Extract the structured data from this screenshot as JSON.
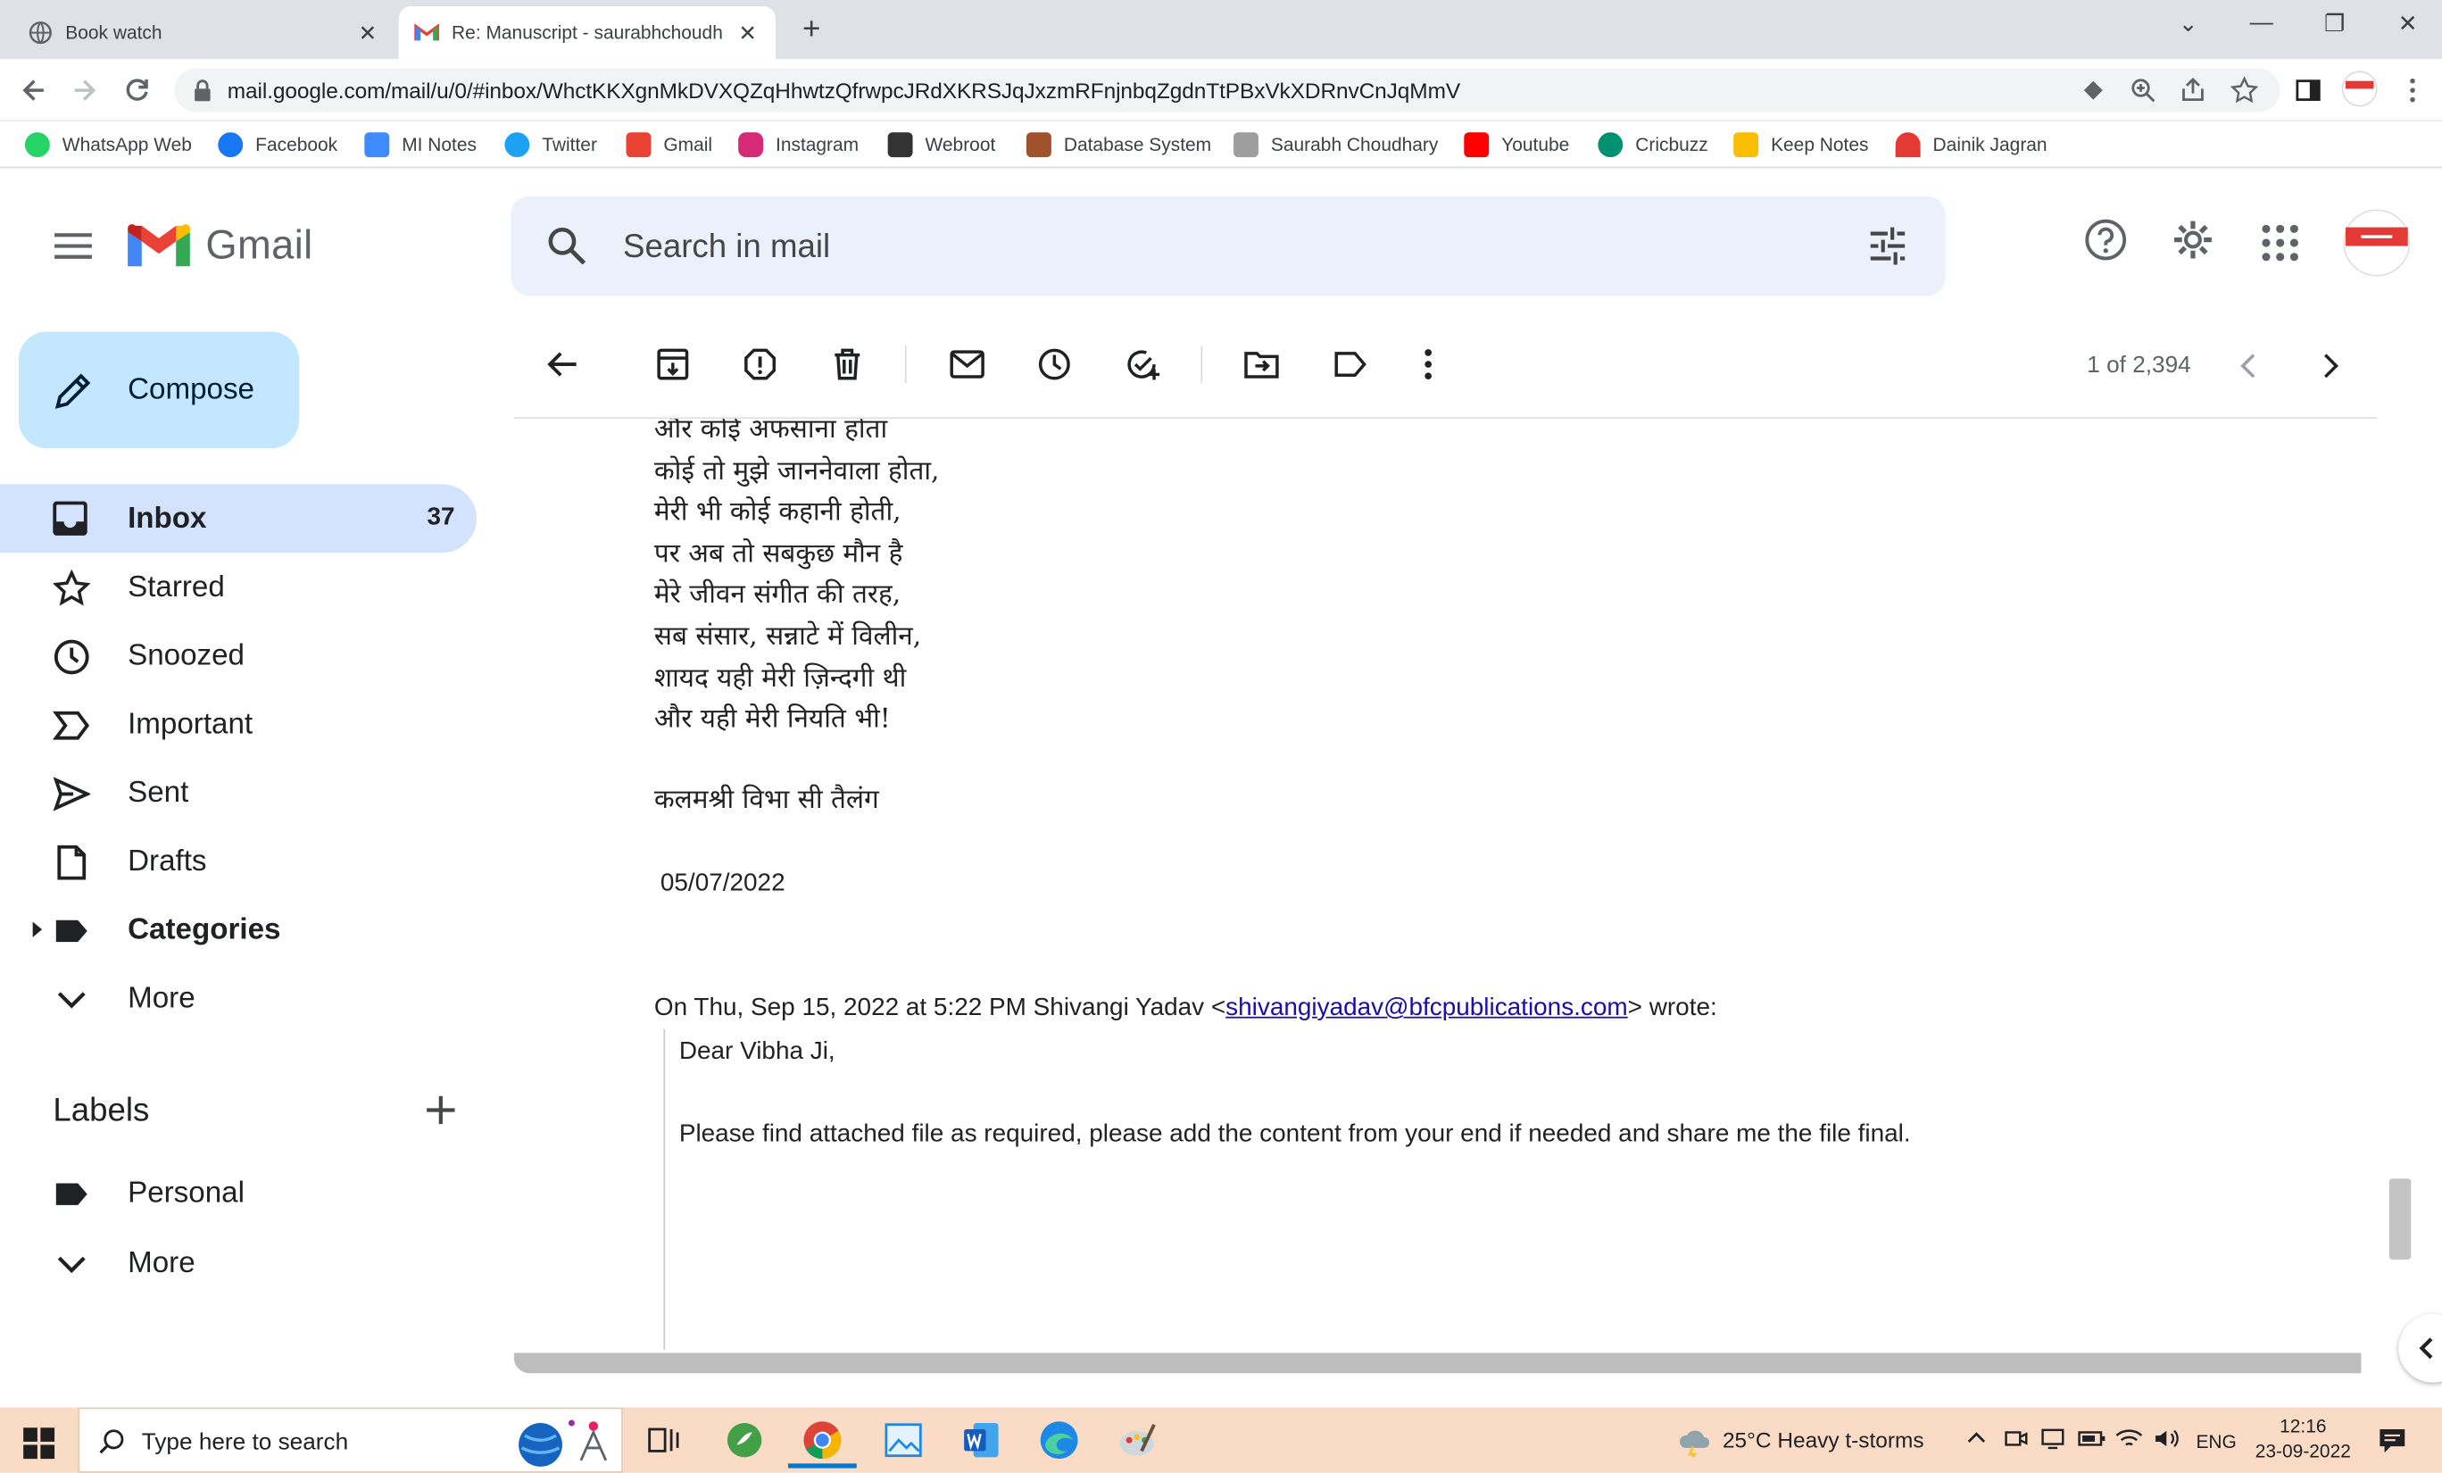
{
  "browser": {
    "tabs": [
      {
        "label": "Book watch",
        "close": "✕"
      },
      {
        "label": "Re: Manuscript - saurabhchoudh",
        "close": "✕"
      }
    ],
    "new_tab": "+",
    "window_controls": {
      "collapse": "⌄",
      "minimize": "—",
      "restore": "❐",
      "close": "✕"
    },
    "url": "mail.google.com/mail/u/0/#inbox/WhctKKXgnMkDVXQZqHhwtzQfrwpcJRdXKRSJqJxzmRFnjnbqZgdnTtPBxVkXDRnvCnJqMmV",
    "bookmarks": [
      {
        "label": "WhatsApp Web",
        "color": "#25d366"
      },
      {
        "label": "Facebook",
        "color": "#1877f2"
      },
      {
        "label": "MI Notes",
        "color": "#3d8bfd"
      },
      {
        "label": "Twitter",
        "color": "#1da1f2"
      },
      {
        "label": "Gmail",
        "color": "#ea4335"
      },
      {
        "label": "Instagram",
        "color": "#d62976"
      },
      {
        "label": "Webroot",
        "color": "#333333"
      },
      {
        "label": "Database System",
        "color": "#a0522d"
      },
      {
        "label": "Saurabh Choudhary",
        "color": "#9e9e9e"
      },
      {
        "label": "Youtube",
        "color": "#ff0000"
      },
      {
        "label": "Cricbuzz",
        "color": "#009270"
      },
      {
        "label": "Keep Notes",
        "color": "#fbbc04"
      },
      {
        "label": "Dainik Jagran",
        "color": "#e53935"
      }
    ]
  },
  "gmail": {
    "logo_text": "Gmail",
    "search_placeholder": "Search in mail",
    "compose_label": "Compose",
    "nav": [
      {
        "label": "Inbox",
        "count": "37"
      },
      {
        "label": "Starred"
      },
      {
        "label": "Snoozed"
      },
      {
        "label": "Important"
      },
      {
        "label": "Sent"
      },
      {
        "label": "Drafts"
      },
      {
        "label": "Categories"
      },
      {
        "label": "More"
      }
    ],
    "labels_title": "Labels",
    "labels": [
      {
        "label": "Personal"
      },
      {
        "label": "More"
      }
    ],
    "counter": "1 of 2,394"
  },
  "email": {
    "poem_lines": [
      "और कोई अफसाना होता",
      "कोई तो मुझे जाननेवाला होता,",
      "मेरी भी कोई कहानी होती,",
      "पर अब तो सबकुछ मौन है",
      "मेरे जीवन संगीत की तरह,",
      "सब संसार, सन्नाटे में विलीन,",
      "शायद यही मेरी ज़िन्दगी थी",
      "और यही मेरी नियति भी!"
    ],
    "signature": "कलमश्री विभा सी तैलंग",
    "date": "05/07/2022",
    "quote_prefix": "On Thu, Sep 15, 2022 at 5:22 PM Shivangi Yadav <",
    "quote_email": "shivangiyadav@bfcpublications.com",
    "quote_suffix": "> wrote:",
    "greeting": "Dear Vibha Ji,",
    "body": "Please find attached file  as required, please add the content from your end if needed and share me the file final."
  },
  "taskbar": {
    "search_placeholder": "Type here to search",
    "weather": "25°C  Heavy t-storms",
    "language": "ENG",
    "time": "12:16",
    "date": "23-09-2022"
  }
}
